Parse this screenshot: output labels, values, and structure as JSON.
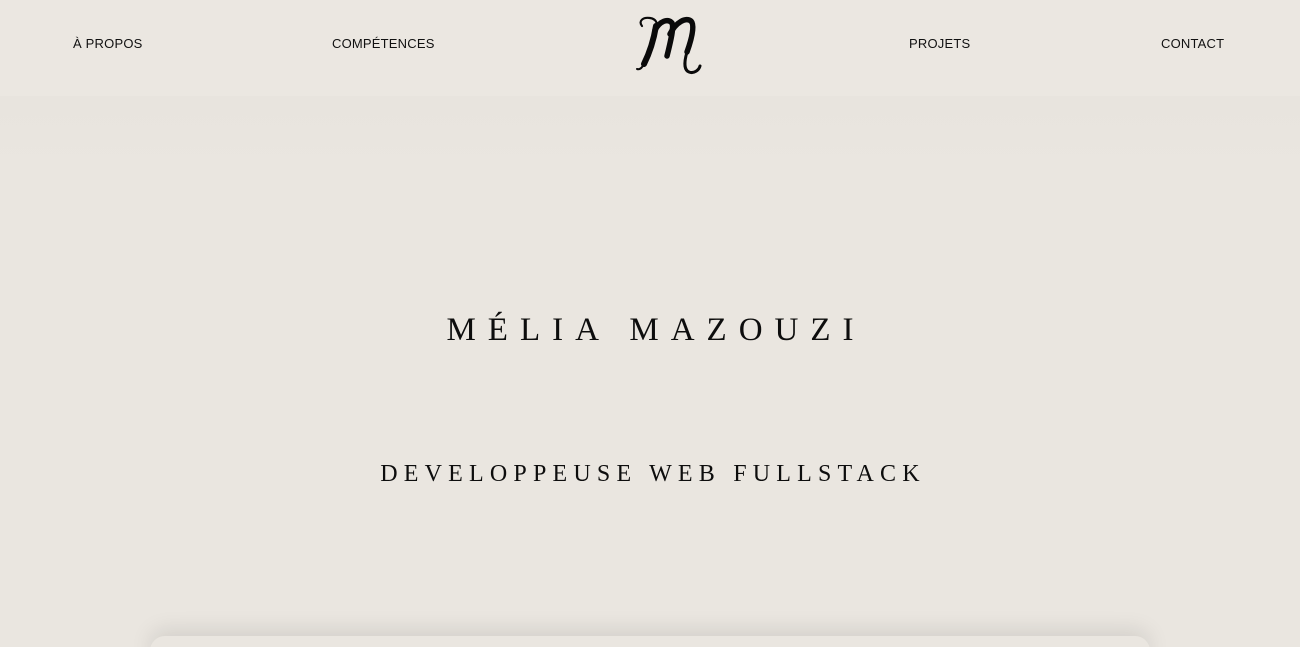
{
  "nav": {
    "items": [
      {
        "label": "À PROPOS"
      },
      {
        "label": "COMPÉTENCES"
      },
      {
        "label": "PROJETS"
      },
      {
        "label": "CONTACT"
      }
    ],
    "logo_icon": "script-m-monogram-icon"
  },
  "hero": {
    "name": "MÉLIA MAZOUZI",
    "subtitle": "DEVELOPPEUSE WEB FULLSTACK"
  },
  "colors": {
    "background": "#eae6e0",
    "text": "#0d0d0d"
  }
}
